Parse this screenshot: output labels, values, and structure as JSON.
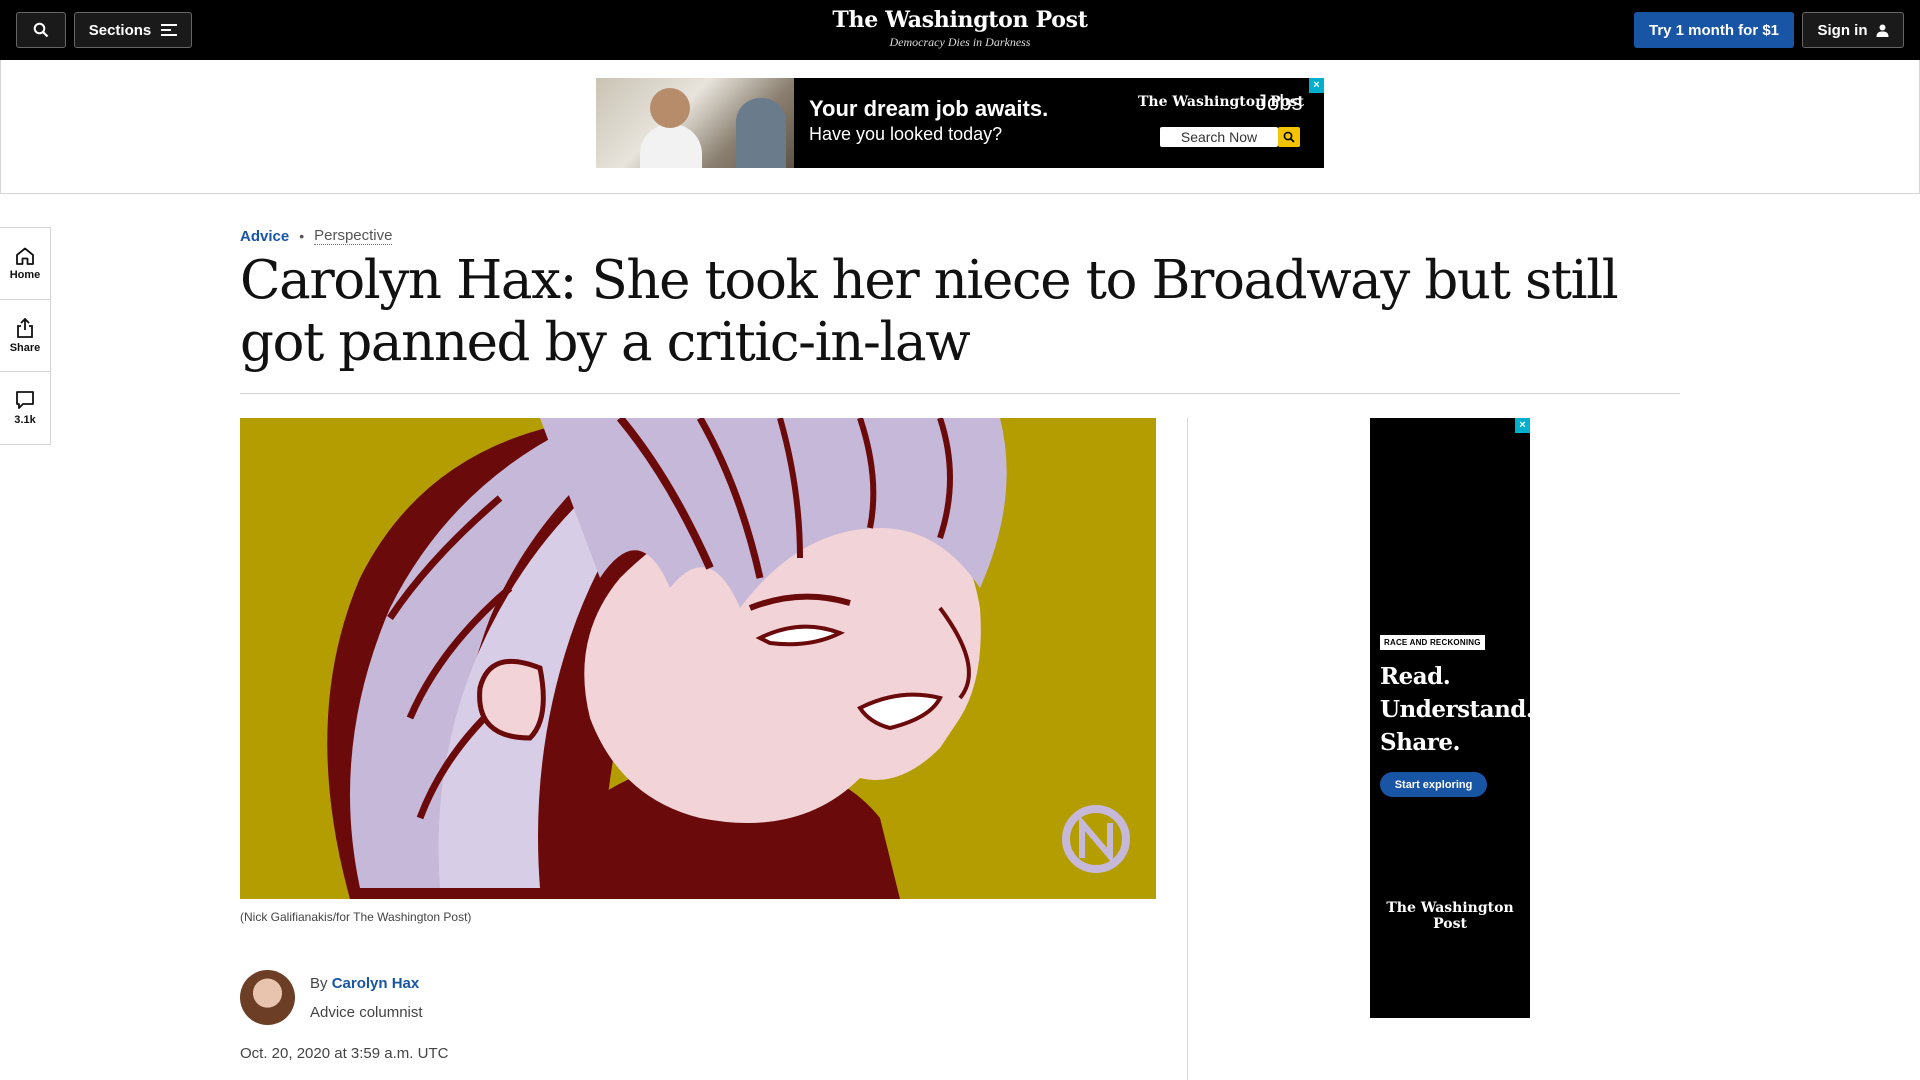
{
  "topbar": {
    "search_icon": "search-icon",
    "sections_label": "Sections",
    "menu_icon": "hamburger-icon",
    "logo_text": "The Washington Post",
    "tagline": "Democracy Dies in Darkness",
    "subscribe_label": "Try 1 month for $1",
    "signin_label": "Sign in",
    "user_icon": "user-icon"
  },
  "leaderboard_ad": {
    "headline": "Your dream job awaits.",
    "subline": "Have you looked today?",
    "logo_text": "The Washington Post",
    "jobs_label": "Jobs",
    "search_label": "Search Now",
    "search_icon": "search-icon",
    "adchoices_icon": "close-x-icon"
  },
  "rail": {
    "items": [
      {
        "label": "Home",
        "icon": "home-icon"
      },
      {
        "label": "Share",
        "icon": "share-icon"
      },
      {
        "label": "3.1k",
        "icon": "comment-icon"
      }
    ]
  },
  "article": {
    "section": "Advice",
    "label": "Perspective",
    "headline": "Carolyn Hax: She took her niece to Broadway but still got panned by a critic-in-law",
    "image_caption": "(Nick Galifianakis/for The Washington Post)",
    "byline_prefix": "By",
    "author": "Carolyn Hax",
    "author_role": "Advice columnist",
    "timestamp": "Oct. 20, 2020 at 3:59 a.m. UTC"
  },
  "side_ad": {
    "badge": "RACE AND RECKONING",
    "lines": [
      "Read.",
      "Understand.",
      "Share."
    ],
    "cta_label": "Start exploring",
    "logo_text": "The Washington Post",
    "adchoices_icon": "close-x-icon"
  },
  "colors": {
    "accent_blue": "#1955a5",
    "topbar_black": "#000000",
    "art_mustard": "#b49d00",
    "art_maroon": "#6b0a0a",
    "art_pink": "#f1d3d8",
    "art_lavender": "#c6b8d8"
  }
}
